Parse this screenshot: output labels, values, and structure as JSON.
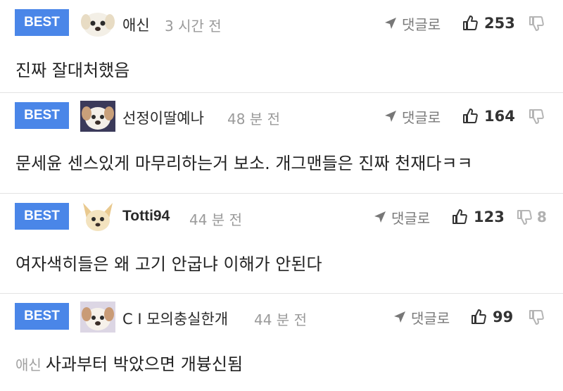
{
  "comments": [
    {
      "badge": "BEST",
      "avatar_icon": "white-dog-avatar-icon",
      "nickname": "애신",
      "time": "3 시간 전",
      "reply_label": "댓글로",
      "likes": "253",
      "dislikes": "",
      "mention": "",
      "text": "진짜 잘대처했음"
    },
    {
      "badge": "BEST",
      "avatar_icon": "puppy-avatar-icon",
      "nickname": "선정이딸예나",
      "time": "48 분 전",
      "reply_label": "댓글로",
      "likes": "164",
      "dislikes": "",
      "mention": "",
      "text": "문세윤 센스있게 마무리하는거 보소. 개그맨들은 진짜 천재다ㅋㅋ"
    },
    {
      "badge": "BEST",
      "avatar_icon": "chihuahua-avatar-icon",
      "nickname": "Totti94",
      "time": "44 분 전",
      "reply_label": "댓글로",
      "likes": "123",
      "dislikes": "8",
      "mention": "",
      "text": "여자색히들은 왜 고기 안굽냐 이해가 안된다"
    },
    {
      "badge": "BEST",
      "avatar_icon": "puppy-avatar-icon",
      "nickname": "C I 모의충실한개",
      "time": "44 분 전",
      "reply_label": "댓글로",
      "likes": "99",
      "dislikes": "",
      "mention": "애신",
      "text": "사과부터 박았으면 개븅신됨"
    }
  ],
  "colors": {
    "badge": "#4a86e8",
    "divider": "#e3e3e3",
    "muted": "#9a9a9a"
  }
}
